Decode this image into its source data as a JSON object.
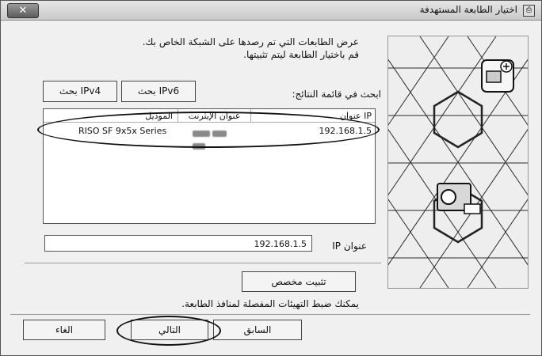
{
  "window": {
    "title": "اختيار الطابعة المستهدفة",
    "close_glyph": "✕"
  },
  "description": {
    "line1": "عرض الطابعات التي تم رصدها على الشبكة الخاص بك.",
    "line2": "قم باختيار الطابعة ليتم تثبيتها."
  },
  "search": {
    "label": "ابحث في قائمة النتائج:",
    "ipv6_button": "بحث IPv6",
    "ipv4_button": "بحث IPv4"
  },
  "list": {
    "columns": {
      "ip": "عنوان IP",
      "mac": "عنوان الإيثرنت",
      "model": "الموديل"
    },
    "rows": [
      {
        "ip": "192.168.1.5",
        "model": "RISO SF 9x5x Series"
      }
    ]
  },
  "ip_field": {
    "label": "عنوان IP",
    "value": "192.168.1.5"
  },
  "custom_install": {
    "button": "تثبيت مخصص",
    "hint": "يمكنك ضبط التهيئات المفصلة لمنافذ الطابعة."
  },
  "footer": {
    "back": "السابق",
    "next": "التالي",
    "cancel": "الغاء"
  },
  "icons": {
    "app": "printer-app-icon",
    "close": "close-icon"
  }
}
